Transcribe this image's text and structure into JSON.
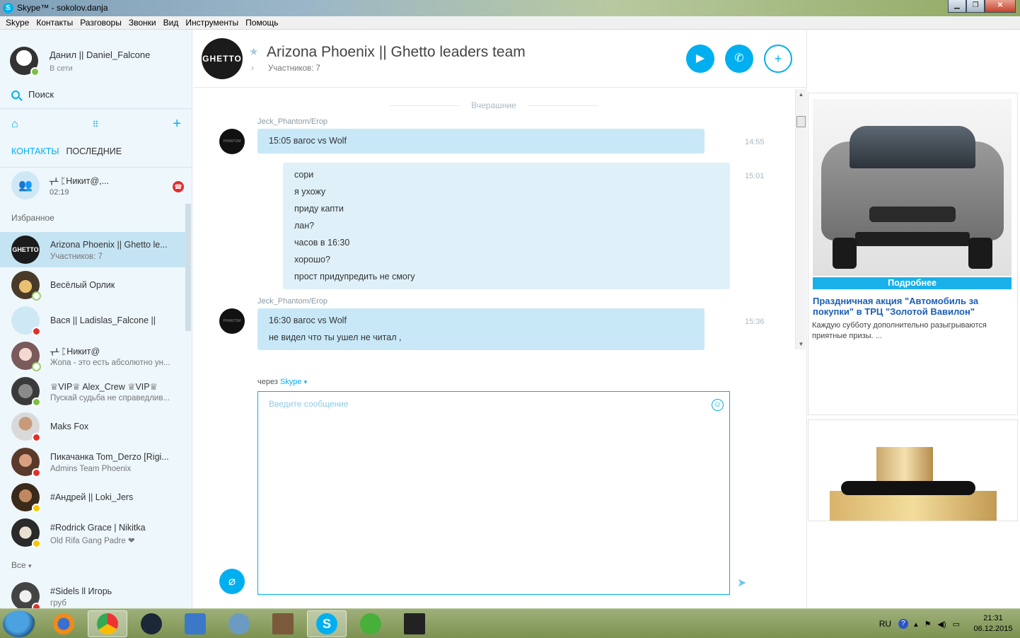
{
  "window": {
    "title": "Skype™ - sokolov.danja",
    "menu": [
      "Skype",
      "Контакты",
      "Разговоры",
      "Звонки",
      "Вид",
      "Инструменты",
      "Помощь"
    ]
  },
  "profile": {
    "name": "Данил || Daniel_Falcone",
    "status": "В сети"
  },
  "search": {
    "label": "Поиск"
  },
  "tabs": {
    "contacts": "КОНТАКТЫ",
    "recent": "ПОСЛЕДНИЕ"
  },
  "recent_call": {
    "name": "ᚁᚆ ᛈНикит@,...",
    "time": "02:19"
  },
  "sections": {
    "favorites": "Избранное",
    "all": "Все"
  },
  "contacts": [
    {
      "name": "Arizona Phoenix || Ghetto le...",
      "sub": "Участников: 7",
      "status": "none"
    },
    {
      "name": "Весёлый Орлик",
      "sub": "",
      "status": "offline"
    },
    {
      "name": "Вася || Ladislas_Falcone ||",
      "sub": "",
      "status": "busy"
    },
    {
      "name": "ᚁᚆ ᛈНикит@",
      "sub": "Жопа - это есть абсолютно ун...",
      "status": "offline"
    },
    {
      "name": "♕VIP♕ Alex_Crew ♕VIP♕",
      "sub": "Пускай судьба не справедлив...",
      "status": "online"
    },
    {
      "name": "Maks Fox",
      "sub": "",
      "status": "busy"
    },
    {
      "name": "Пикачанка Tom_Derzo [Rigi...",
      "sub": "Admins Team Phoenix",
      "status": "busy"
    },
    {
      "name": "#Андрей || Loki_Jers",
      "sub": "",
      "status": "away"
    },
    {
      "name": "#Rodrick Grace | Nikitka",
      "sub": "Old Rifa Gang Padre ❤",
      "status": "away"
    }
  ],
  "contacts_all": [
    {
      "name": "#Sidels ll Игорь",
      "sub": "груб",
      "status": "busy"
    }
  ],
  "conversation": {
    "avatar_text": "GHETTO",
    "title": "Arizona Phoenix || Ghetto leaders team",
    "subtitle": "Участников: 7",
    "day_separator": "Вчерашние",
    "avatar_label": "PHANTOM",
    "messages": [
      {
        "sender": "Jeck_Phantom/Erop",
        "lines": [
          "15:05 вагос vs Wolf"
        ],
        "time": "14:55",
        "direction": "in"
      },
      {
        "sender": "",
        "lines": [
          "сори",
          "я ухожу",
          "приду капти",
          "лан?",
          "часов в 16:30",
          "хорошо?",
          "прост придупредить не смогу"
        ],
        "time": "15:01",
        "direction": "out"
      },
      {
        "sender": "Jeck_Phantom/Erop",
        "lines": [
          "16:30 вагос vs Wolf",
          "не видел что ты ушел не читал ,"
        ],
        "time": "15:36",
        "direction": "in"
      }
    ],
    "via_label": "через",
    "via_service": "Skype",
    "compose_placeholder": "Введите сообщение"
  },
  "ads": {
    "button": "Подробнее",
    "title": "Праздничная акция \"Автомобиль за покупки\" в ТРЦ \"Золотой Вавилон\"",
    "text": "Каждую субботу дополнительно разыгрываются приятные призы. ..."
  },
  "taskbar": {
    "lang": "RU",
    "time": "21:31",
    "date": "06.12.2015",
    "apps": [
      "firefox",
      "chrome",
      "steam",
      "generic",
      "dolphin",
      "game",
      "skype",
      "utorrent",
      "cs"
    ]
  },
  "colors": {
    "accent": "#00aff0",
    "busy": "#e0312e",
    "online": "#7cc043",
    "away": "#f5c800"
  }
}
